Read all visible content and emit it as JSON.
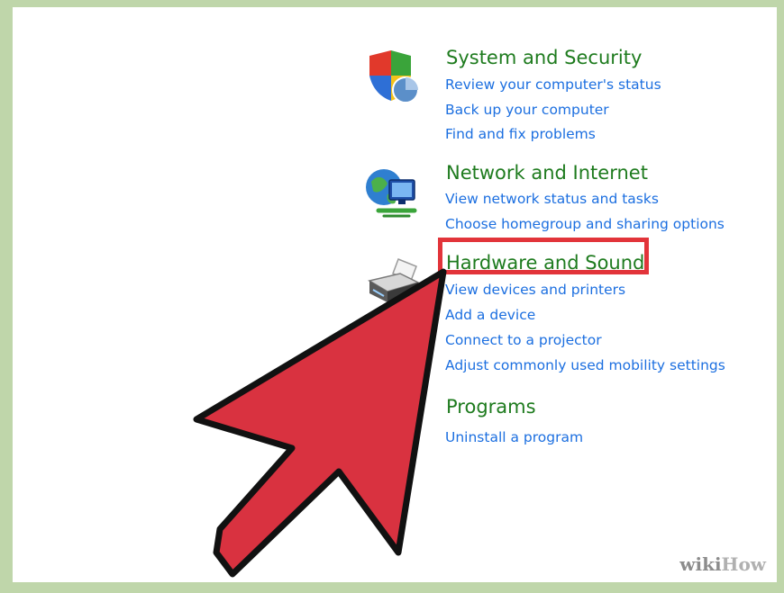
{
  "categories": [
    {
      "title": "System and Security",
      "icon": "shield-icon",
      "links": [
        "Review your computer's status",
        "Back up your computer",
        "Find and fix problems"
      ]
    },
    {
      "title": "Network and Internet",
      "icon": "network-globe-icon",
      "links": [
        "View network status and tasks",
        "Choose homegroup and sharing options"
      ]
    },
    {
      "title": "Hardware and Sound",
      "icon": "printer-icon",
      "links": [
        "View devices and printers",
        "Add a device",
        "Connect to a projector",
        "Adjust commonly used mobility settings"
      ]
    },
    {
      "title": "Programs",
      "icon": "programs-icon",
      "links": [
        "Uninstall a program"
      ]
    }
  ],
  "watermark": {
    "part1": "wiki",
    "part2": "How"
  },
  "colors": {
    "category_title": "#1e7b1e",
    "link": "#1c6fe0",
    "highlight": "#e2343a",
    "arrow_fill": "#d93240",
    "frame": "#bfd6aa"
  }
}
